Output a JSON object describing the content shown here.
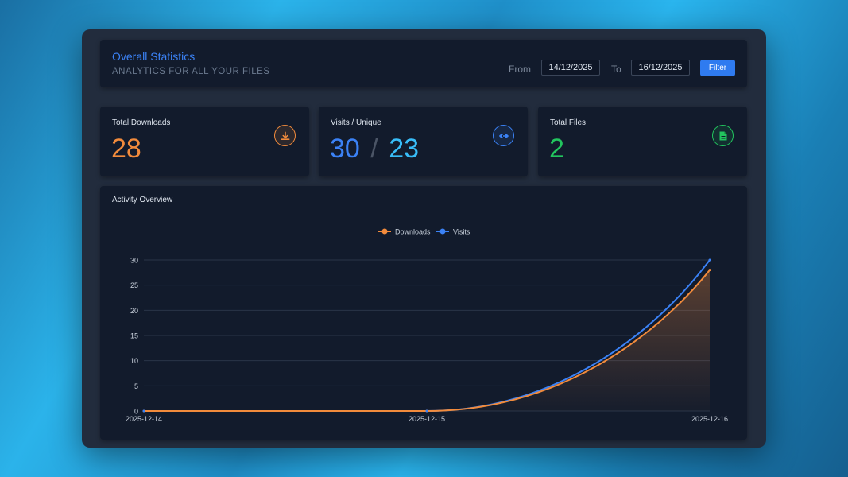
{
  "header": {
    "title": "Overall Statistics",
    "subtitle": "ANALYTICS FOR ALL YOUR FILES",
    "from_label": "From",
    "from_value": "14/12/2025",
    "to_label": "To",
    "to_value": "16/12/2025",
    "filter_label": "Filter"
  },
  "stats": {
    "downloads": {
      "label": "Total Downloads",
      "value": "28",
      "color": "#f28b3c",
      "icon": "download-icon"
    },
    "visits": {
      "label": "Visits / Unique",
      "value": "30",
      "separator": "/",
      "unique": "23",
      "color": "#3b82f6",
      "unique_color": "#38bdf8",
      "icon": "eye-icon"
    },
    "files": {
      "label": "Total Files",
      "value": "2",
      "color": "#22c55e",
      "icon": "file-icon"
    }
  },
  "activity": {
    "title": "Activity Overview"
  },
  "chart_data": {
    "type": "line",
    "title": "",
    "x": [
      "2025-12-14",
      "2025-12-15",
      "2025-12-16"
    ],
    "series": [
      {
        "name": "Downloads",
        "values": [
          0,
          0,
          28
        ],
        "color": "#f28b3c"
      },
      {
        "name": "Visits",
        "values": [
          0,
          0,
          30
        ],
        "color": "#3b82f6"
      }
    ],
    "yticks": [
      0,
      5,
      10,
      15,
      20,
      25,
      30
    ],
    "ylim": [
      0,
      30
    ],
    "legend": "top-center",
    "grid": true,
    "xlabel": "",
    "ylabel": ""
  }
}
